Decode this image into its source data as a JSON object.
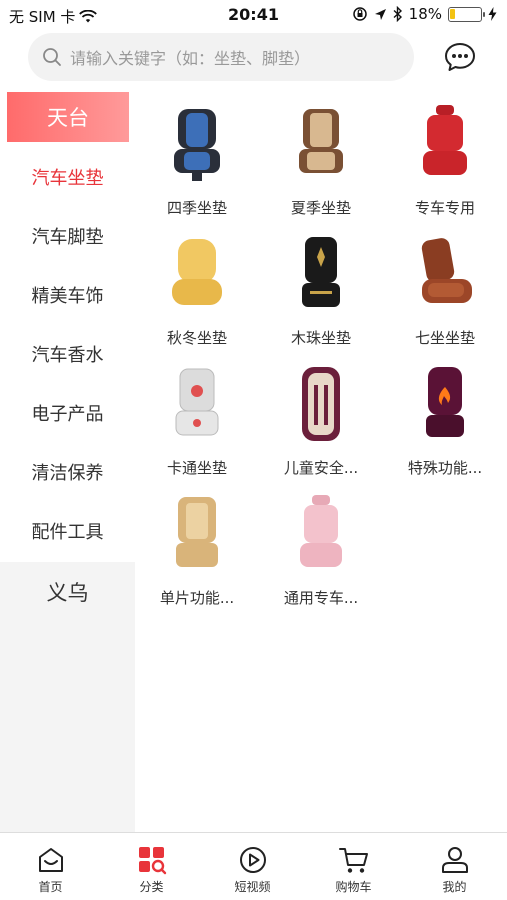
{
  "status_bar": {
    "carrier": "无 SIM 卡",
    "time": "20:41",
    "battery_text": "18%",
    "battery_level": 0.18,
    "icons": [
      "wifi-icon",
      "orientation-lock-icon",
      "location-icon",
      "bluetooth-icon",
      "charging-icon"
    ]
  },
  "search": {
    "placeholder": "请输入关键字（如：坐垫、脚垫）"
  },
  "sidebar": {
    "groups": [
      {
        "header": "天台",
        "items": [
          {
            "label": "汽车坐垫",
            "active": true
          },
          {
            "label": "汽车脚垫",
            "active": false
          },
          {
            "label": "精美车饰",
            "active": false
          },
          {
            "label": "汽车香水",
            "active": false
          },
          {
            "label": "电子产品",
            "active": false
          },
          {
            "label": "清洁保养",
            "active": false
          },
          {
            "label": "配件工具",
            "active": false
          }
        ]
      },
      {
        "header": "义乌",
        "items": []
      }
    ]
  },
  "products": [
    {
      "name": "四季坐垫",
      "icon": "seat-cushion-blue"
    },
    {
      "name": "夏季坐垫",
      "icon": "seat-cushion-beaded"
    },
    {
      "name": "专车专用",
      "icon": "seat-cushion-red"
    },
    {
      "name": "秋冬坐垫",
      "icon": "seat-cushion-wool"
    },
    {
      "name": "木珠坐垫",
      "icon": "seat-cushion-wood-bead"
    },
    {
      "name": "七坐坐垫",
      "icon": "seat-cushion-brown-leather"
    },
    {
      "name": "卡通坐垫",
      "icon": "seat-cushion-cartoon"
    },
    {
      "name": "儿童安全...",
      "icon": "child-safety-seat"
    },
    {
      "name": "特殊功能...",
      "icon": "seat-cushion-heated"
    },
    {
      "name": "单片功能...",
      "icon": "seat-cushion-single"
    },
    {
      "name": "通用专车...",
      "icon": "seat-cushion-pink"
    }
  ],
  "tabbar": {
    "tabs": [
      {
        "label": "首页",
        "icon": "home-icon",
        "active": false
      },
      {
        "label": "分类",
        "icon": "category-icon",
        "active": true
      },
      {
        "label": "短视频",
        "icon": "video-icon",
        "active": false
      },
      {
        "label": "购物车",
        "icon": "cart-icon",
        "active": false
      },
      {
        "label": "我的",
        "icon": "profile-icon",
        "active": false
      }
    ]
  },
  "colors": {
    "accent": "#e8343a",
    "accent_gradient_start": "#ff6b6b",
    "accent_gradient_end": "#ff9a9a"
  }
}
